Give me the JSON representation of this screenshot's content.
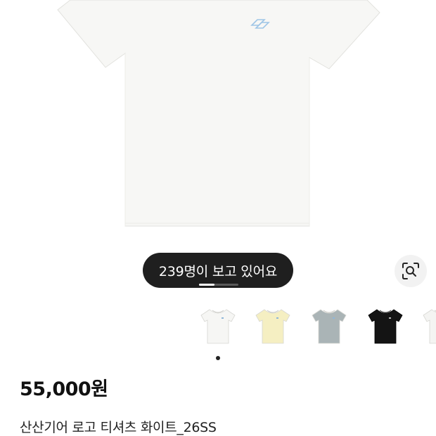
{
  "gallery": {
    "main_image": "white-t-shirt-product-photo",
    "viewers_text": "239명이 보고 있어요",
    "lens_icon": "lens-search-icon",
    "pager_progress": 0.4
  },
  "color_thumbnails": [
    {
      "swatch": "white",
      "color": "#f6f6f4"
    },
    {
      "swatch": "butter-yellow",
      "color": "#f5efc2"
    },
    {
      "swatch": "gray-blue",
      "color": "#aab4b6"
    },
    {
      "swatch": "black",
      "color": "#141414"
    },
    {
      "swatch": "white",
      "color": "#f4f4f2"
    }
  ],
  "product": {
    "price": "55,000원",
    "name": "산산기어 로고 티셔츠 화이트_26SS"
  }
}
